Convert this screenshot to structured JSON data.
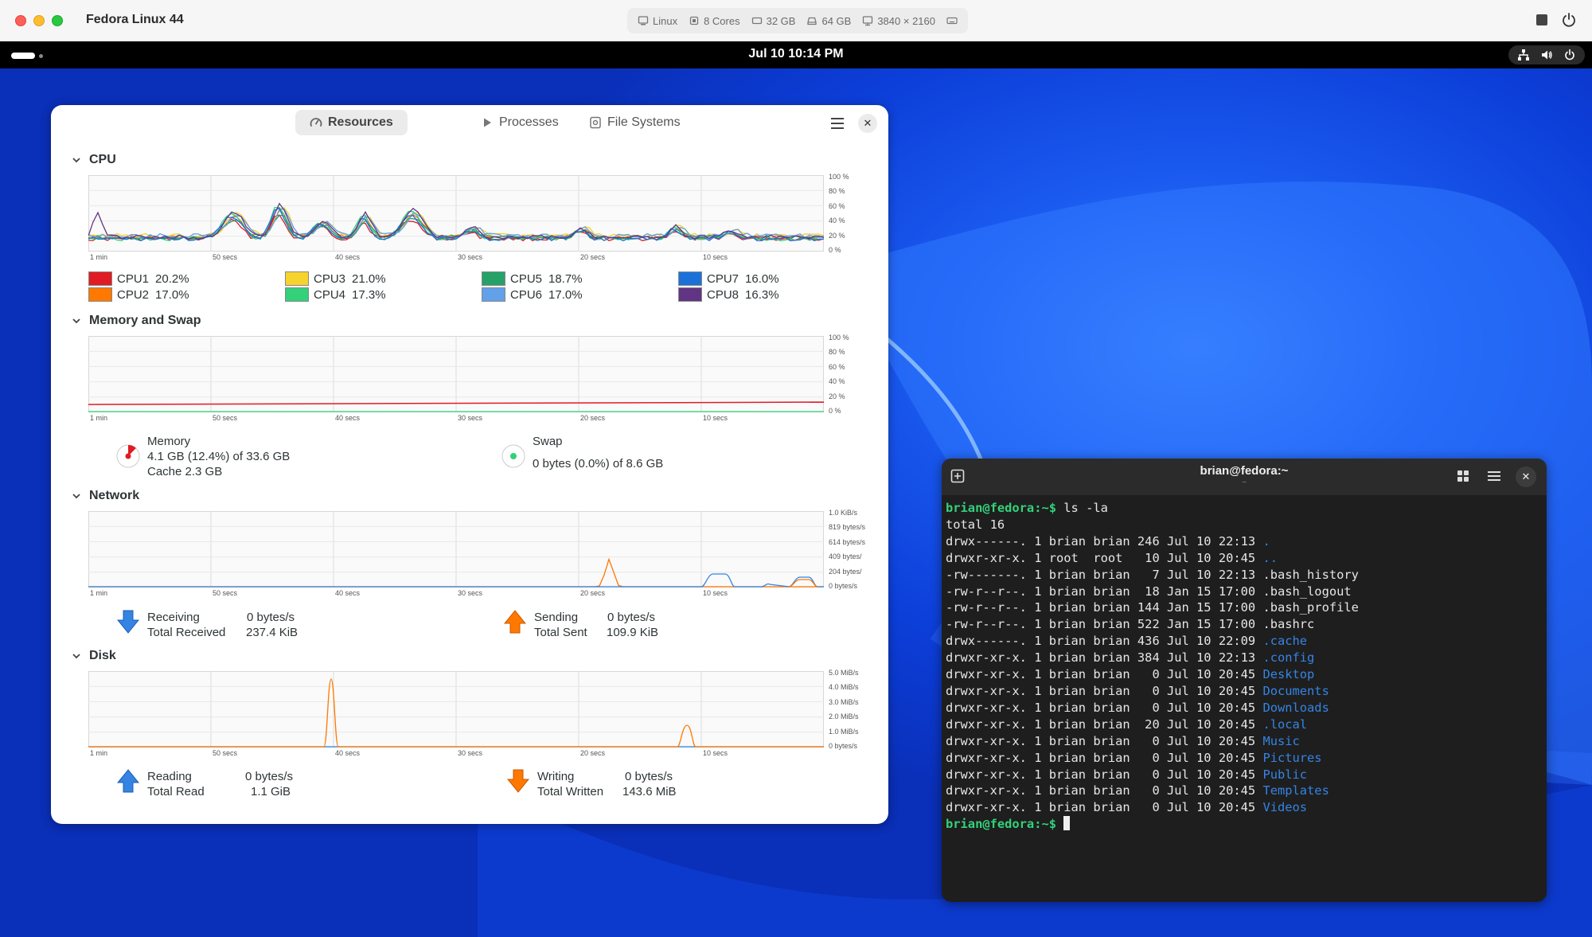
{
  "vm": {
    "title": "Fedora Linux 44",
    "info": [
      {
        "icon": "os-icon",
        "label": "Linux"
      },
      {
        "icon": "cpu-chip-icon",
        "label": "8 Cores"
      },
      {
        "icon": "memory-icon",
        "label": "32 GB"
      },
      {
        "icon": "disk-icon",
        "label": "64 GB"
      },
      {
        "icon": "display-icon",
        "label": "3840 × 2160"
      }
    ]
  },
  "topbar": {
    "clock": "Jul 10  10:14 PM"
  },
  "sysmon": {
    "tabs": [
      {
        "icon": "gauge-icon",
        "label": "Resources"
      },
      {
        "icon": "play-icon",
        "label": "Processes"
      },
      {
        "icon": "disk-drive-icon",
        "label": "File Systems"
      }
    ],
    "x_ticks": [
      "1 min",
      "50 secs",
      "40 secs",
      "30 secs",
      "20 secs",
      "10 secs"
    ],
    "cpu": {
      "title": "CPU",
      "y_ticks": [
        "100 %",
        "80 %",
        "60 %",
        "40 %",
        "20 %",
        "0 %"
      ],
      "cores": [
        {
          "name": "CPU1",
          "value": "20.2%",
          "color": "#e01b24"
        },
        {
          "name": "CPU2",
          "value": "17.0%",
          "color": "#ff7800"
        },
        {
          "name": "CPU3",
          "value": "21.0%",
          "color": "#f6d32d"
        },
        {
          "name": "CPU4",
          "value": "17.3%",
          "color": "#33d17a"
        },
        {
          "name": "CPU5",
          "value": "18.7%",
          "color": "#26a269"
        },
        {
          "name": "CPU6",
          "value": "17.0%",
          "color": "#62a0ea"
        },
        {
          "name": "CPU7",
          "value": "16.0%",
          "color": "#1c71d8"
        },
        {
          "name": "CPU8",
          "value": "16.3%",
          "color": "#613583"
        }
      ]
    },
    "memory": {
      "title": "Memory and Swap",
      "y_ticks": [
        "100 %",
        "80 %",
        "60 %",
        "40 %",
        "20 %",
        "0 %"
      ],
      "mem_label": "Memory",
      "mem_usage": "4.1 GB (12.4%) of 33.6 GB",
      "mem_cache": "Cache 2.3 GB",
      "mem_percent": 12.4,
      "swap_label": "Swap",
      "swap_usage": "0 bytes (0.0%) of 8.6 GB",
      "mem_color": "#e01b24",
      "swap_color": "#33d17a"
    },
    "network": {
      "title": "Network",
      "y_ticks": [
        "1.0 KiB/s",
        "819 bytes/s",
        "614 bytes/s",
        "409 bytes/",
        "204 bytes/",
        "0 bytes/s"
      ],
      "receiving_label": "Receiving",
      "receiving_value": "0 bytes/s",
      "total_received_label": "Total Received",
      "total_received_value": "237.4 KiB",
      "sending_label": "Sending",
      "sending_value": "0 bytes/s",
      "total_sent_label": "Total Sent",
      "total_sent_value": "109.9 KiB"
    },
    "disk": {
      "title": "Disk",
      "y_ticks": [
        "5.0 MiB/s",
        "4.0 MiB/s",
        "3.0 MiB/s",
        "2.0 MiB/s",
        "1.0 MiB/s",
        "0 bytes/s"
      ],
      "reading_label": "Reading",
      "reading_value": "0 bytes/s",
      "total_read_label": "Total Read",
      "total_read_value": "1.1 GiB",
      "writing_label": "Writing",
      "writing_value": "0 bytes/s",
      "total_written_label": "Total Written",
      "total_written_value": "143.6 MiB"
    }
  },
  "terminal": {
    "title": "brian@fedora:~",
    "subtitle": "~",
    "prompt": "brian@fedora:~$",
    "command": " ls -la",
    "total": "total 16",
    "entries": [
      {
        "meta": "drwx------. 1 brian brian 246 Jul 10 22:13 ",
        "name": ".",
        "dir": true
      },
      {
        "meta": "drwxr-xr-x. 1 root  root   10 Jul 10 20:45 ",
        "name": "..",
        "dir": true
      },
      {
        "meta": "-rw-------. 1 brian brian   7 Jul 10 22:13 ",
        "name": ".bash_history",
        "dir": false
      },
      {
        "meta": "-rw-r--r--. 1 brian brian  18 Jan 15 17:00 ",
        "name": ".bash_logout",
        "dir": false
      },
      {
        "meta": "-rw-r--r--. 1 brian brian 144 Jan 15 17:00 ",
        "name": ".bash_profile",
        "dir": false
      },
      {
        "meta": "-rw-r--r--. 1 brian brian 522 Jan 15 17:00 ",
        "name": ".bashrc",
        "dir": false
      },
      {
        "meta": "drwx------. 1 brian brian 436 Jul 10 22:09 ",
        "name": ".cache",
        "dir": true
      },
      {
        "meta": "drwxr-xr-x. 1 brian brian 384 Jul 10 22:13 ",
        "name": ".config",
        "dir": true
      },
      {
        "meta": "drwxr-xr-x. 1 brian brian   0 Jul 10 20:45 ",
        "name": "Desktop",
        "dir": true
      },
      {
        "meta": "drwxr-xr-x. 1 brian brian   0 Jul 10 20:45 ",
        "name": "Documents",
        "dir": true
      },
      {
        "meta": "drwxr-xr-x. 1 brian brian   0 Jul 10 20:45 ",
        "name": "Downloads",
        "dir": true
      },
      {
        "meta": "drwxr-xr-x. 1 brian brian  20 Jul 10 20:45 ",
        "name": ".local",
        "dir": true
      },
      {
        "meta": "drwxr-xr-x. 1 brian brian   0 Jul 10 20:45 ",
        "name": "Music",
        "dir": true
      },
      {
        "meta": "drwxr-xr-x. 1 brian brian   0 Jul 10 20:45 ",
        "name": "Pictures",
        "dir": true
      },
      {
        "meta": "drwxr-xr-x. 1 brian brian   0 Jul 10 20:45 ",
        "name": "Public",
        "dir": true
      },
      {
        "meta": "drwxr-xr-x. 1 brian brian   0 Jul 10 20:45 ",
        "name": "Templates",
        "dir": true
      },
      {
        "meta": "drwxr-xr-x. 1 brian brian   0 Jul 10 20:45 ",
        "name": "Videos",
        "dir": true
      }
    ]
  }
}
